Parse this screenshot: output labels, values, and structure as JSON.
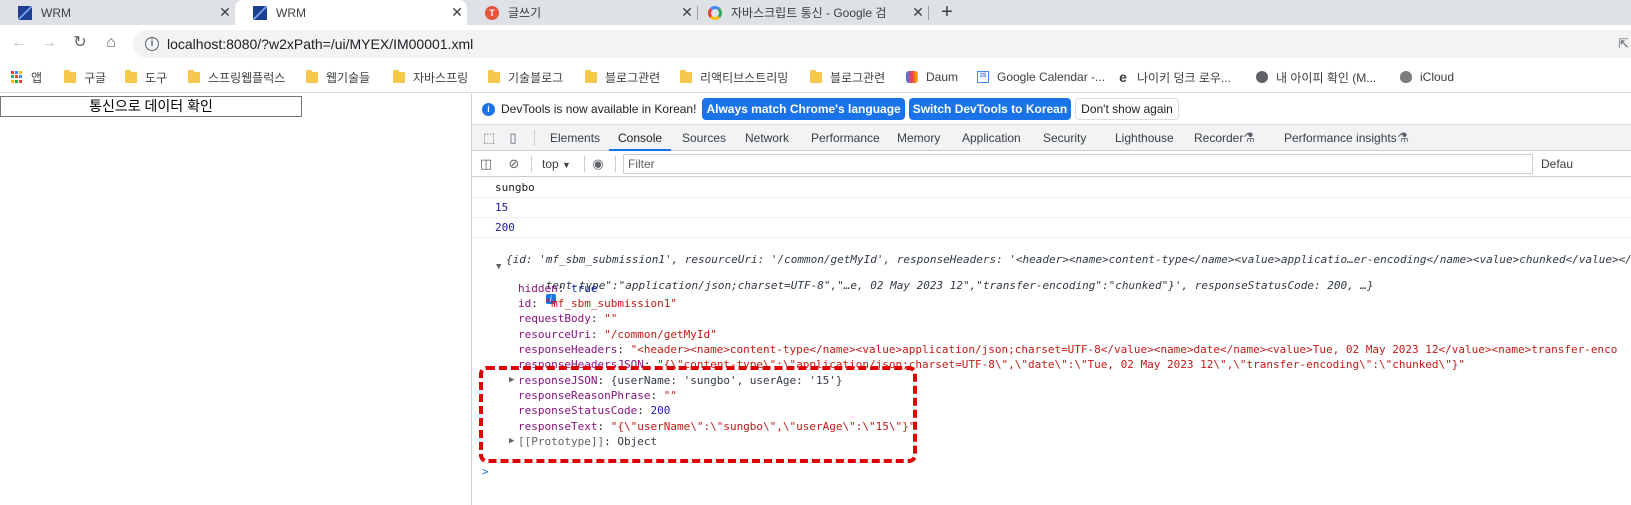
{
  "browser": {
    "tabs": [
      {
        "title": "WRM",
        "icon": "wrm-icon",
        "active": false
      },
      {
        "title": "WRM",
        "icon": "wrm-icon",
        "active": true
      },
      {
        "title": "글쓰기",
        "icon": "tistory-icon",
        "active": false
      },
      {
        "title": "자바스크립트 통신 - Google 검",
        "icon": "google-icon",
        "active": false
      }
    ],
    "new_tab": "+",
    "url": "localhost:8080/?w2xPath=/ui/MYEX/IM00001.xml",
    "bookmarks": [
      {
        "label": "앱",
        "icon": "apps-grid-icon"
      },
      {
        "label": "구글",
        "icon": "folder-icon"
      },
      {
        "label": "도구",
        "icon": "folder-icon"
      },
      {
        "label": "스프링웹플럭스",
        "icon": "folder-icon"
      },
      {
        "label": "웹기술들",
        "icon": "folder-icon"
      },
      {
        "label": "자바스프링",
        "icon": "folder-icon"
      },
      {
        "label": "기술블로그",
        "icon": "folder-icon"
      },
      {
        "label": "블로그관련",
        "icon": "folder-icon"
      },
      {
        "label": "리액티브스트리밍",
        "icon": "folder-icon"
      },
      {
        "label": "블로그관련",
        "icon": "folder-icon"
      },
      {
        "label": "Daum",
        "icon": "daum-icon"
      },
      {
        "label": "Google Calendar -...",
        "icon": "google-calendar-icon"
      },
      {
        "label": "나이키 덩크 로우...",
        "icon": "nike-icon"
      },
      {
        "label": "내 아이피 확인 (M...",
        "icon": "globe-icon"
      },
      {
        "label": "iCloud",
        "icon": "apple-icon"
      }
    ]
  },
  "page": {
    "button_label": "통신으로 데이터 확인"
  },
  "devtools": {
    "infobar": {
      "message": "DevTools is now available in Korean!",
      "btn_match": "Always match Chrome's language",
      "btn_switch": "Switch DevTools to Korean",
      "btn_dismiss": "Don't show again"
    },
    "tabs": [
      "Elements",
      "Console",
      "Sources",
      "Network",
      "Performance",
      "Memory",
      "Application",
      "Security",
      "Lighthouse",
      "Recorder",
      "Performance insights"
    ],
    "active_tab": "Console",
    "console_toolbar": {
      "context": "top",
      "filter_placeholder": "Filter",
      "levels": "Defau"
    },
    "logs": {
      "l1": "sungbo",
      "l2": "15",
      "l3": "200"
    },
    "object": {
      "summary_line1": "{id: 'mf_sbm_submission1', resourceUri: '/common/getMyId', responseHeaders: '<header><name>content-type</name><value>applicatio…er-encoding</name><value>chunked</value></",
      "summary_line2": "tent-type\":\"application/json;charset=UTF-8\",\"…e, 02 May 2023 12\",\"transfer-encoding\":\"chunked\"}', responseStatusCode: 200, …}",
      "props": [
        {
          "key": "hidden",
          "value": "true",
          "kind": "kw"
        },
        {
          "key": "id",
          "value": "\"mf_sbm_submission1\"",
          "kind": "str"
        },
        {
          "key": "requestBody",
          "value": "\"\"",
          "kind": "str"
        },
        {
          "key": "resourceUri",
          "value": "\"/common/getMyId\"",
          "kind": "str"
        },
        {
          "key": "responseHeaders",
          "value": "\"<header><name>content-type</name><value>application/json;charset=UTF-8</value><name>date</name><value>Tue, 02 May 2023 12</value><name>transfer-enco",
          "kind": "str"
        },
        {
          "key": "responseHeadersJSON",
          "value": "\"{\\\"content-type\\\":\\\"application/json;charset=UTF-8\\\",\\\"date\\\":\\\"Tue, 02 May 2023 12\\\",\\\"transfer-encoding\\\":\\\"chunked\\\"}\"",
          "kind": "str"
        },
        {
          "key": "responseJSON",
          "value": "{userName: 'sungbo', userAge: '15'}",
          "kind": "obj"
        },
        {
          "key": "responseReasonPhrase",
          "value": "\"\"",
          "kind": "str"
        },
        {
          "key": "responseStatusCode",
          "value": "200",
          "kind": "num"
        },
        {
          "key": "responseText",
          "value": "\"{\\\"userName\\\":\\\"sungbo\\\",\\\"userAge\\\":\\\"15\\\"}\"",
          "kind": "str"
        },
        {
          "key": "[[Prototype]]",
          "value": "Object",
          "kind": "obj"
        }
      ]
    },
    "prompt": ">"
  },
  "colors": {
    "accent": "#1a73e8",
    "highlight_box": "#e00000",
    "string": "#c41a16",
    "property": "#881280",
    "number": "#1a1aa6"
  }
}
